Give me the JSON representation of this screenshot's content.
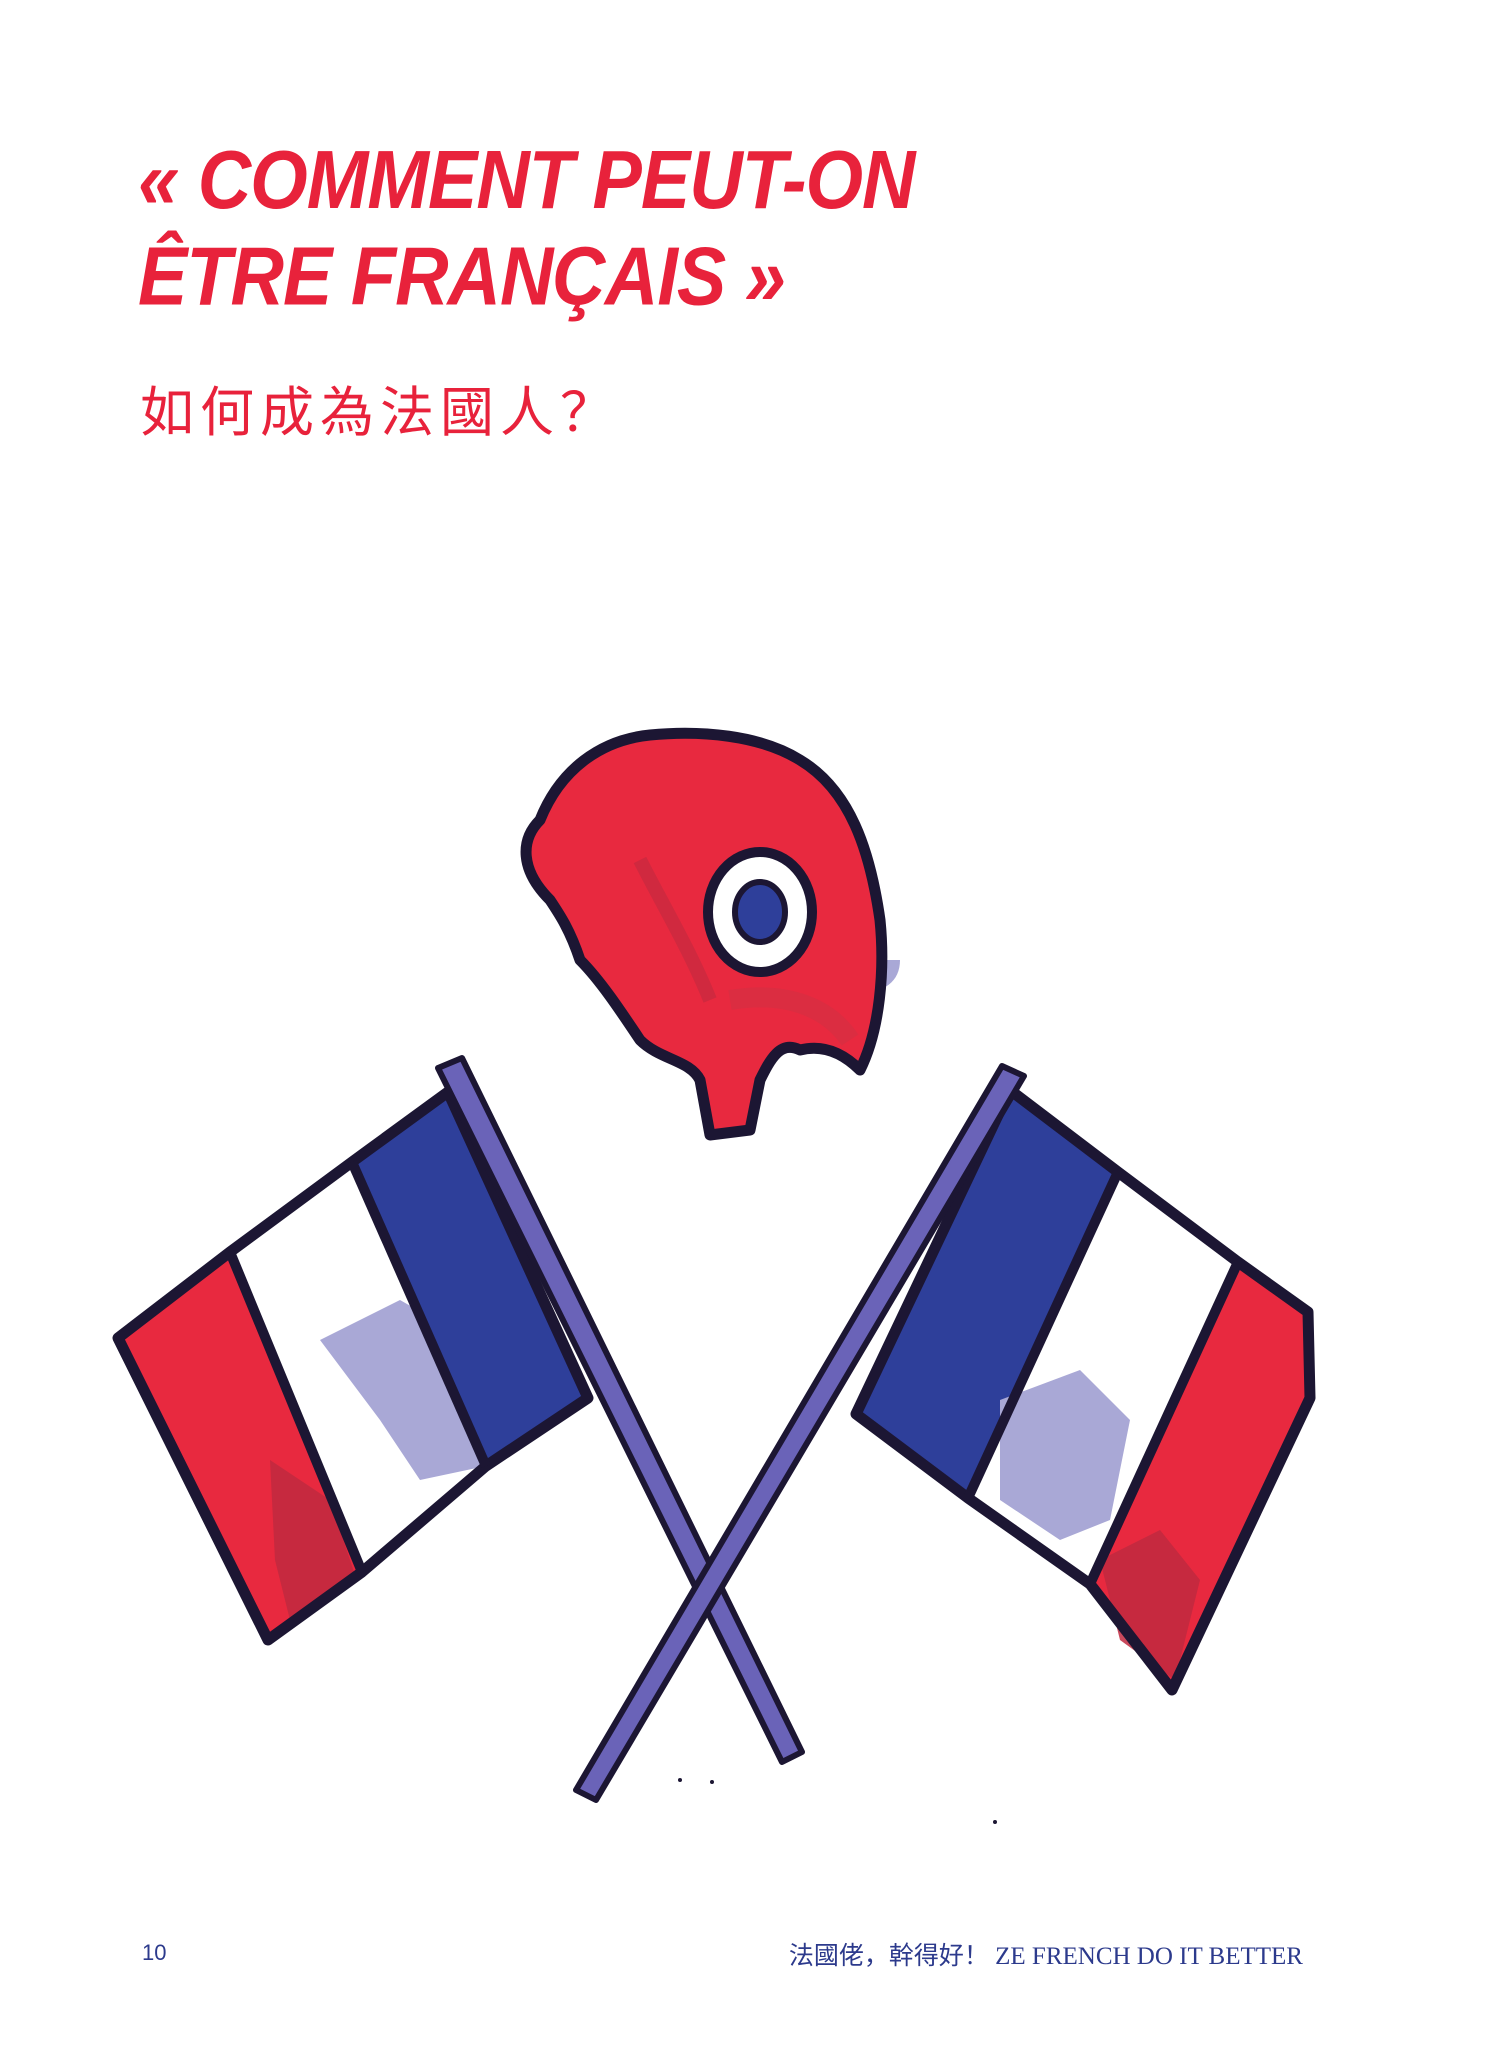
{
  "title": {
    "line1": "« COMMENT PEUT-ON",
    "line2": "ÊTRE FRANÇAIS »"
  },
  "subtitle": "如何成為法國人？",
  "illustration": {
    "items": [
      "phrygian-cap",
      "cockade",
      "french-flag-left",
      "french-flag-right",
      "crossed-flagpoles"
    ],
    "colors": {
      "red": "#e8293f",
      "blue": "#2e3f9a",
      "white": "#ffffff",
      "shadow": "#a9a8d6",
      "outline": "#1c1633",
      "pole": "#6a63b8"
    }
  },
  "footer": {
    "page_number": "10",
    "running_head": "法國佬，幹得好！ ZE FRENCH DO IT BETTER"
  }
}
